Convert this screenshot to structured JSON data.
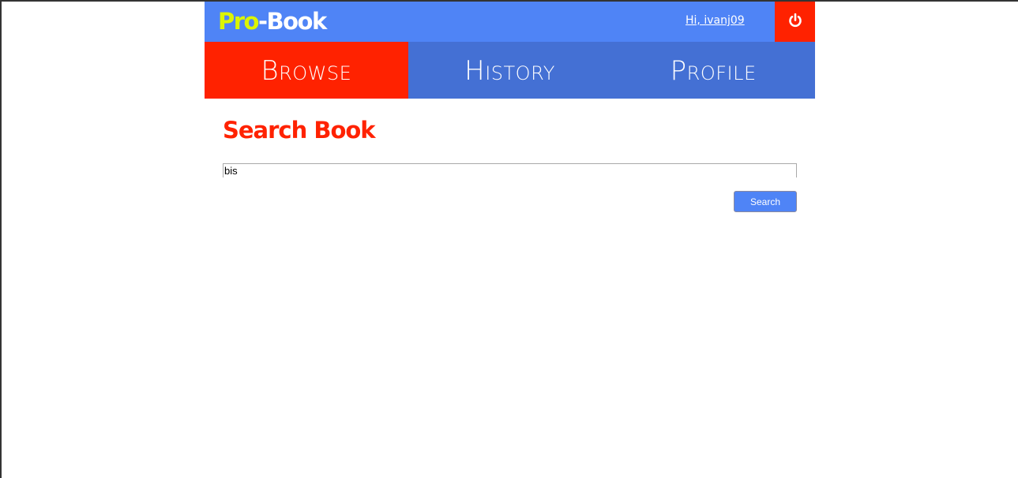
{
  "header": {
    "logo_pro": "Pro",
    "logo_rest": "-Book",
    "greeting": "Hi, ivanj09",
    "logout_icon": "power-icon"
  },
  "nav": {
    "tabs": [
      {
        "label": "Browse",
        "active": true
      },
      {
        "label": "History",
        "active": false
      },
      {
        "label": "Profile",
        "active": false
      }
    ]
  },
  "main": {
    "title": "Search Book",
    "search_value": "bis",
    "search_button_label": "Search"
  },
  "colors": {
    "header_blue": "#4f84f6",
    "nav_blue": "#4470d4",
    "accent_red": "#ff2200",
    "logo_yellow": "#dcf500"
  }
}
